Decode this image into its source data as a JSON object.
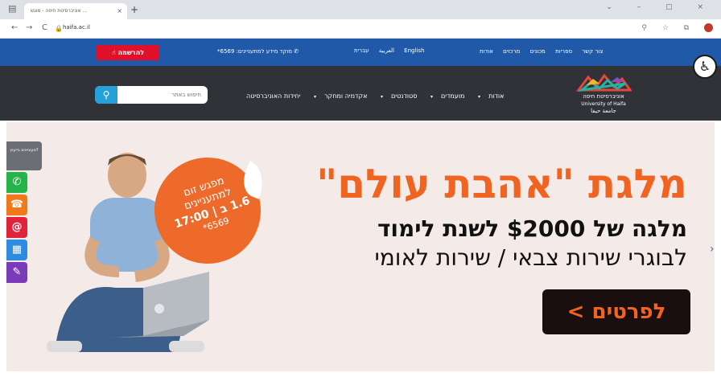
{
  "browser": {
    "menu_icon": "menu-icon",
    "tab_title": "אוניברסיטת חיפה - מוגש ...",
    "tab_close": "×",
    "new_tab": "+",
    "back": "←",
    "forward": "→",
    "reload": "C",
    "url": "haifa.ac.il",
    "window_controls": "⌄ – ▢ ×",
    "addr_icons": "⚲ ☆ ⧉"
  },
  "topbar": {
    "register_label": "להרשמה",
    "phone_text": "מוקד מידע למתעניינים: 6569*",
    "languages": [
      "English",
      "עברית",
      "العربية"
    ],
    "links": [
      "צור קשר",
      "ספריות",
      "מכונים",
      "מרכזים",
      "אודות"
    ]
  },
  "accessibility_icon": "♿",
  "mainnav": {
    "search_placeholder": "חיפוש באתר",
    "search_icon": "search-icon",
    "menu": [
      "אודות",
      "מועמדים",
      "סטודנטים",
      "אקדמיה ומחקר",
      "יחידות האוניברסיטה"
    ],
    "logo_text_he": "אוניברסיטת חיפה",
    "logo_text_en": "University of Haifa",
    "logo_text_ar": "جامعة حيفا"
  },
  "hero": {
    "title": "מלגת \"אהבת עולם\"",
    "line2": "מלגה של $2000 לשנת לימוד",
    "line3": "לבוגרי שירות צבאי / שירות לאומי",
    "button_label": "לפרטים >",
    "badge": {
      "l1": "מפגש זום",
      "l2": "למתעניינים",
      "l3": "1.6 ב | 17:00",
      "l4": "6569*"
    },
    "next_arrow": "›"
  },
  "side": {
    "top_label": "מעוניינים בייעוץ?",
    "icons": [
      {
        "name": "whatsapp-icon",
        "glyph": "✆",
        "color": "#25b34a"
      },
      {
        "name": "phone-icon",
        "glyph": "☎",
        "color": "#f07a1a"
      },
      {
        "name": "email-icon",
        "glyph": "@",
        "color": "#e0233b"
      },
      {
        "name": "calendar-icon",
        "glyph": "▦",
        "color": "#2d8be0"
      },
      {
        "name": "form-icon",
        "glyph": "✎",
        "color": "#7a3bb8"
      }
    ]
  },
  "colors": {
    "topbar": "#1f59a8",
    "nav": "#303238",
    "accent_orange": "#f06422",
    "register_red": "#e0102a"
  }
}
